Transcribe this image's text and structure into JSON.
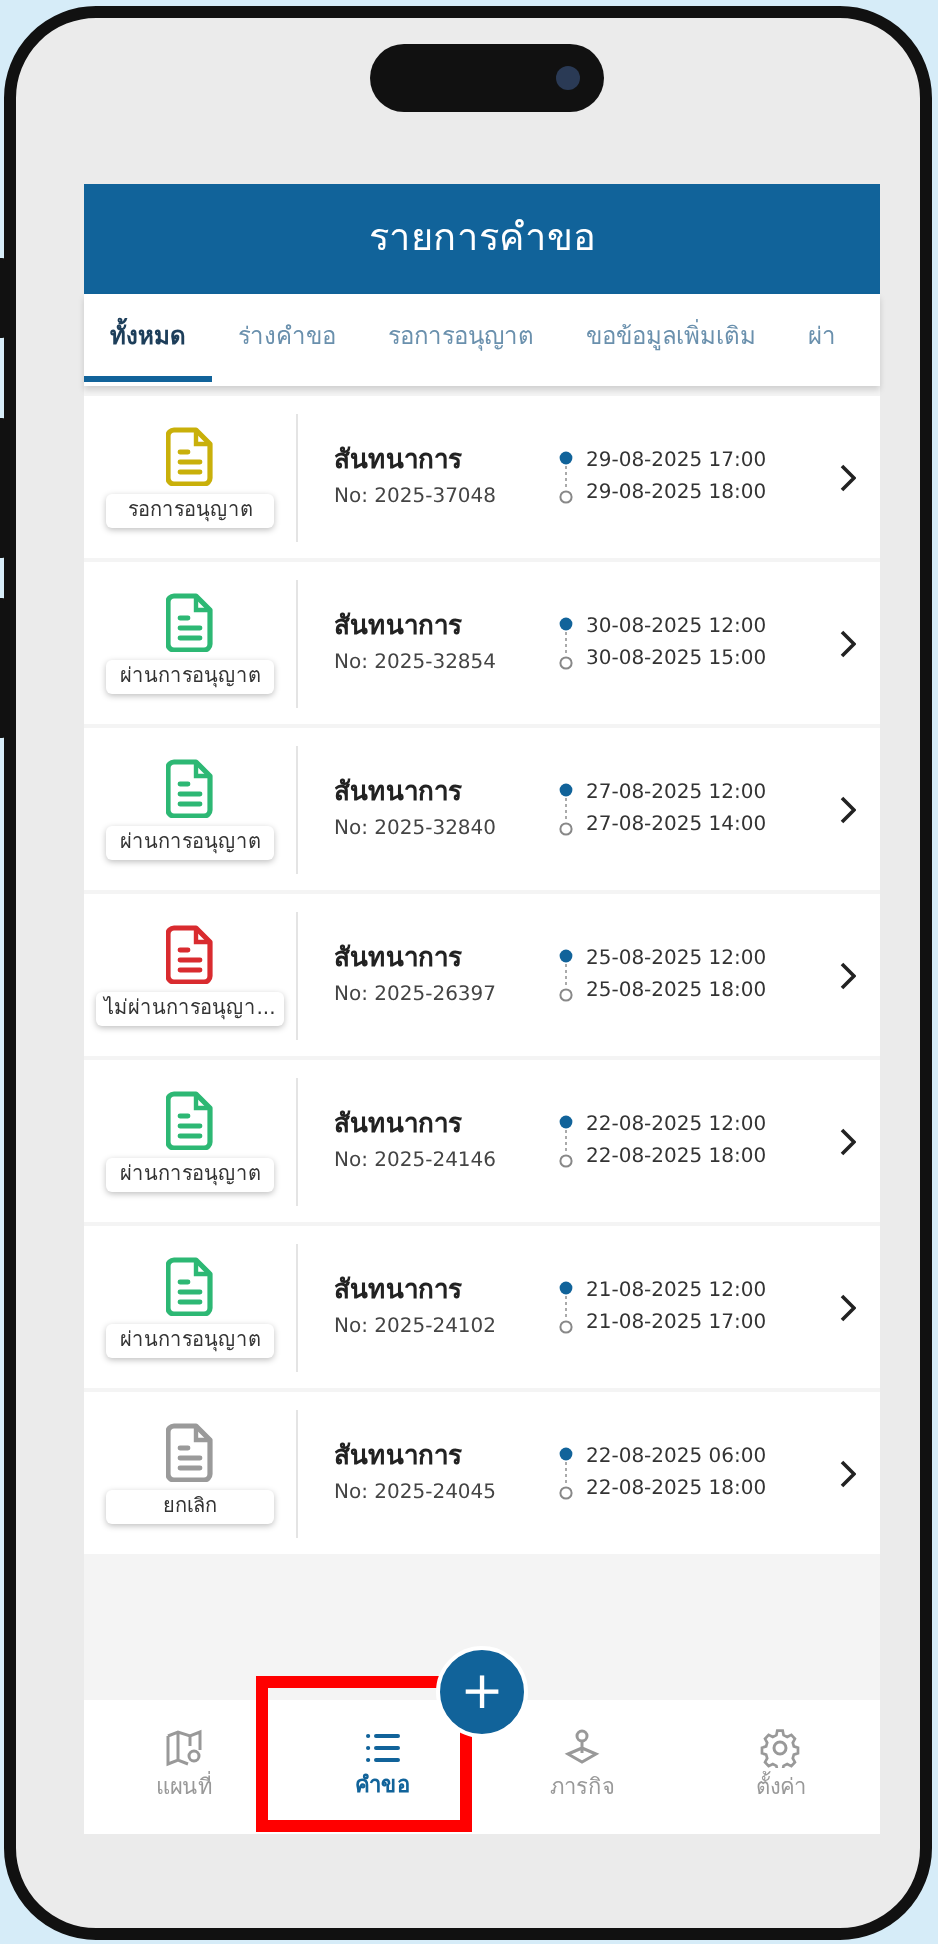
{
  "header": {
    "title": "รายการคำขอ"
  },
  "tabs": [
    {
      "label": "ทั้งหมด",
      "selected": true
    },
    {
      "label": "ร่างคำขอ",
      "selected": false
    },
    {
      "label": "รอการอนุญาต",
      "selected": false
    },
    {
      "label": "ขอข้อมูลเพิ่มเติม",
      "selected": false
    },
    {
      "label": "ผ่า",
      "selected": false
    }
  ],
  "requests": [
    {
      "status": "รอการอนุญาต",
      "color": "#c9b00a",
      "title": "สันทนาการ",
      "number": "No: 2025-37048",
      "start": "29-08-2025 17:00",
      "end": "29-08-2025 18:00"
    },
    {
      "status": "ผ่านการอนุญาต",
      "color": "#2db874",
      "title": "สันทนาการ",
      "number": "No: 2025-32854",
      "start": "30-08-2025 12:00",
      "end": "30-08-2025 15:00"
    },
    {
      "status": "ผ่านการอนุญาต",
      "color": "#2db874",
      "title": "สันทนาการ",
      "number": "No: 2025-32840",
      "start": "27-08-2025 12:00",
      "end": "27-08-2025 14:00"
    },
    {
      "status": "ไม่ผ่านการอนุญา...",
      "color": "#d92b2f",
      "title": "สันทนาการ",
      "number": "No: 2025-26397",
      "start": "25-08-2025 12:00",
      "end": "25-08-2025 18:00"
    },
    {
      "status": "ผ่านการอนุญาต",
      "color": "#2db874",
      "title": "สันทนาการ",
      "number": "No: 2025-24146",
      "start": "22-08-2025 12:00",
      "end": "22-08-2025 18:00"
    },
    {
      "status": "ผ่านการอนุญาต",
      "color": "#2db874",
      "title": "สันทนาการ",
      "number": "No: 2025-24102",
      "start": "21-08-2025 12:00",
      "end": "21-08-2025 17:00"
    },
    {
      "status": "ยกเลิก",
      "color": "#9a9a9a",
      "title": "สันทนาการ",
      "number": "No: 2025-24045",
      "start": "22-08-2025 06:00",
      "end": "22-08-2025 18:00"
    }
  ],
  "fab": {
    "label": "+"
  },
  "bottom_nav": [
    {
      "kind": "map",
      "label": "แผนที่",
      "selected": false,
      "highlighted": false
    },
    {
      "kind": "list",
      "label": "คำขอ",
      "selected": true,
      "highlighted": true
    },
    {
      "kind": "joystick",
      "label": "ภารกิจ",
      "selected": false,
      "highlighted": false
    },
    {
      "kind": "gear",
      "label": "ตั้งค่า",
      "selected": false,
      "highlighted": false
    }
  ]
}
